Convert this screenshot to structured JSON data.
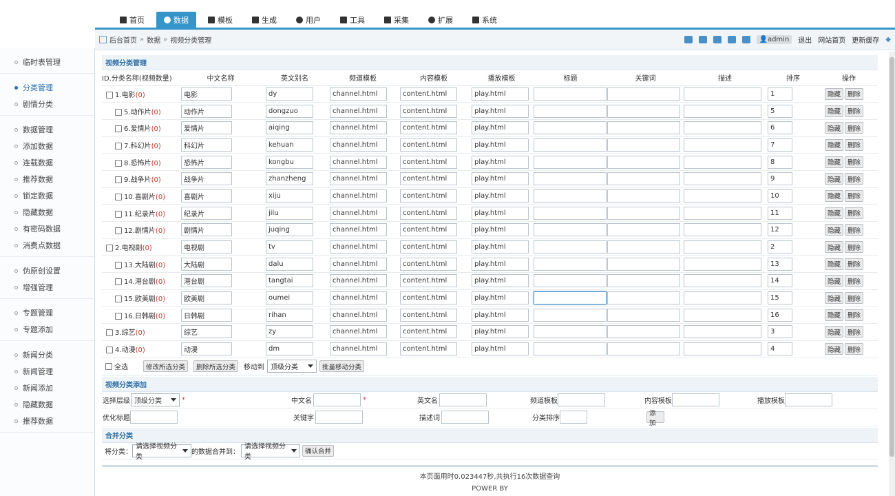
{
  "nav": {
    "items": [
      {
        "label": "首页",
        "icon": "home-icon"
      },
      {
        "label": "数据",
        "icon": "database-icon"
      },
      {
        "label": "模板",
        "icon": "file-icon"
      },
      {
        "label": "生成",
        "icon": "list-icon"
      },
      {
        "label": "用户",
        "icon": "user-icon"
      },
      {
        "label": "工具",
        "icon": "wrench-icon"
      },
      {
        "label": "采集",
        "icon": "magnet-icon"
      },
      {
        "label": "扩展",
        "icon": "puzzle-icon"
      },
      {
        "label": "系统",
        "icon": "gear-icon"
      }
    ],
    "active": 1
  },
  "breadcrumb": {
    "home": "后台首页",
    "data": "数据",
    "current": "视频分类管理"
  },
  "toolbar": {
    "user": "admin",
    "logout": "退出",
    "site_home": "网站首页",
    "clear_cache": "更新缓存"
  },
  "sidebar": {
    "groups": [
      [
        "临时表管理"
      ],
      [
        "分类管理",
        "剧情分类"
      ],
      [
        "数据管理",
        "添加数据",
        "连载数据",
        "推荐数据",
        "锁定数据",
        "隐藏数据",
        "有密码数据",
        "消费点数据"
      ],
      [
        "伪原创设置",
        "增强管理"
      ],
      [
        "专题管理",
        "专题添加"
      ],
      [
        "新闻分类",
        "新闻管理",
        "新闻添加",
        "隐藏数据",
        "推荐数据"
      ]
    ],
    "active": "分类管理"
  },
  "section1": {
    "title": "视频分类管理"
  },
  "table": {
    "headers": [
      "ID.分类名称(视频数量)",
      "中文名称",
      "英文别名",
      "频道模板",
      "内容模板",
      "播放模板",
      "标题",
      "关键词",
      "描述",
      "排序",
      "操作"
    ],
    "rows": [
      {
        "id": "1",
        "name": "电影",
        "count": "0",
        "cn": "电影",
        "en": "dy",
        "channel": "channel.html",
        "content": "content.html",
        "play": "play.html",
        "sort": "1",
        "child": false
      },
      {
        "id": "5",
        "name": "动作片",
        "count": "0",
        "cn": "动作片",
        "en": "dongzuo",
        "channel": "channel.html",
        "content": "content.html",
        "play": "play.html",
        "sort": "5",
        "child": true
      },
      {
        "id": "6",
        "name": "爱情片",
        "count": "0",
        "cn": "爱情片",
        "en": "aiqing",
        "channel": "channel.html",
        "content": "content.html",
        "play": "play.html",
        "sort": "6",
        "child": true
      },
      {
        "id": "7",
        "name": "科幻片",
        "count": "0",
        "cn": "科幻片",
        "en": "kehuan",
        "channel": "channel.html",
        "content": "content.html",
        "play": "play.html",
        "sort": "7",
        "child": true
      },
      {
        "id": "8",
        "name": "恐怖片",
        "count": "0",
        "cn": "恐怖片",
        "en": "kongbu",
        "channel": "channel.html",
        "content": "content.html",
        "play": "play.html",
        "sort": "8",
        "child": true
      },
      {
        "id": "9",
        "name": "战争片",
        "count": "0",
        "cn": "战争片",
        "en": "zhanzheng",
        "channel": "channel.html",
        "content": "content.html",
        "play": "play.html",
        "sort": "9",
        "child": true
      },
      {
        "id": "10",
        "name": "喜剧片",
        "count": "0",
        "cn": "喜剧片",
        "en": "xiju",
        "channel": "channel.html",
        "content": "content.html",
        "play": "play.html",
        "sort": "10",
        "child": true
      },
      {
        "id": "11",
        "name": "纪录片",
        "count": "0",
        "cn": "纪录片",
        "en": "jilu",
        "channel": "channel.html",
        "content": "content.html",
        "play": "play.html",
        "sort": "11",
        "child": true
      },
      {
        "id": "12",
        "name": "剧情片",
        "count": "0",
        "cn": "剧情片",
        "en": "juqing",
        "channel": "channel.html",
        "content": "content.html",
        "play": "play.html",
        "sort": "12",
        "child": true
      },
      {
        "id": "2",
        "name": "电视剧",
        "count": "0",
        "cn": "电视剧",
        "en": "tv",
        "channel": "channel.html",
        "content": "content.html",
        "play": "play.html",
        "sort": "2",
        "child": false
      },
      {
        "id": "13",
        "name": "大陆剧",
        "count": "0",
        "cn": "大陆剧",
        "en": "dalu",
        "channel": "channel.html",
        "content": "content.html",
        "play": "play.html",
        "sort": "13",
        "child": true
      },
      {
        "id": "14",
        "name": "港台剧",
        "count": "0",
        "cn": "港台剧",
        "en": "tangtai",
        "channel": "channel.html",
        "content": "content.html",
        "play": "play.html",
        "sort": "14",
        "child": true
      },
      {
        "id": "15",
        "name": "欧美剧",
        "count": "0",
        "cn": "欧美剧",
        "en": "oumei",
        "channel": "channel.html",
        "content": "content.html",
        "play": "play.html",
        "sort": "15",
        "child": true
      },
      {
        "id": "16",
        "name": "日韩剧",
        "count": "0",
        "cn": "日韩剧",
        "en": "rihan",
        "channel": "channel.html",
        "content": "content.html",
        "play": "play.html",
        "sort": "16",
        "child": true
      },
      {
        "id": "3",
        "name": "综艺",
        "count": "0",
        "cn": "综艺",
        "en": "zy",
        "channel": "channel.html",
        "content": "content.html",
        "play": "play.html",
        "sort": "3",
        "child": false
      },
      {
        "id": "4",
        "name": "动漫",
        "count": "0",
        "cn": "动漫",
        "en": "dm",
        "channel": "channel.html",
        "content": "content.html",
        "play": "play.html",
        "sort": "4",
        "child": false
      }
    ],
    "hide_label": "隐藏",
    "delete_label": "删除"
  },
  "batch": {
    "select_all": "全选",
    "modify": "修改所选分类",
    "delete": "删除所选分类",
    "move_to": "移动到",
    "move_select": "顶级分类",
    "batch_move": "批量移动分类"
  },
  "section2": {
    "title": "视频分类添加",
    "level_label": "选择层级",
    "level_value": "顶级分类",
    "cn_label": "中文名",
    "en_label": "英文名",
    "channel_label": "频道模板",
    "content_label": "内容模板",
    "play_label": "播放模板",
    "seo_title_label": "优化标题",
    "keywords_label": "关键字",
    "desc_label": "描述词",
    "sort_label": "分类排序",
    "add_button": "添 加"
  },
  "section3": {
    "title": "合并分类",
    "from_label": "将分类：",
    "from_select": "请选择视频分类",
    "merge_to_label": "的数据合并到：",
    "to_select": "请选择视频分类",
    "confirm": "确认合并"
  },
  "footer": {
    "stats": "本页面用时0.023447秒,共执行16次数据查询",
    "power": "POWER BY"
  }
}
